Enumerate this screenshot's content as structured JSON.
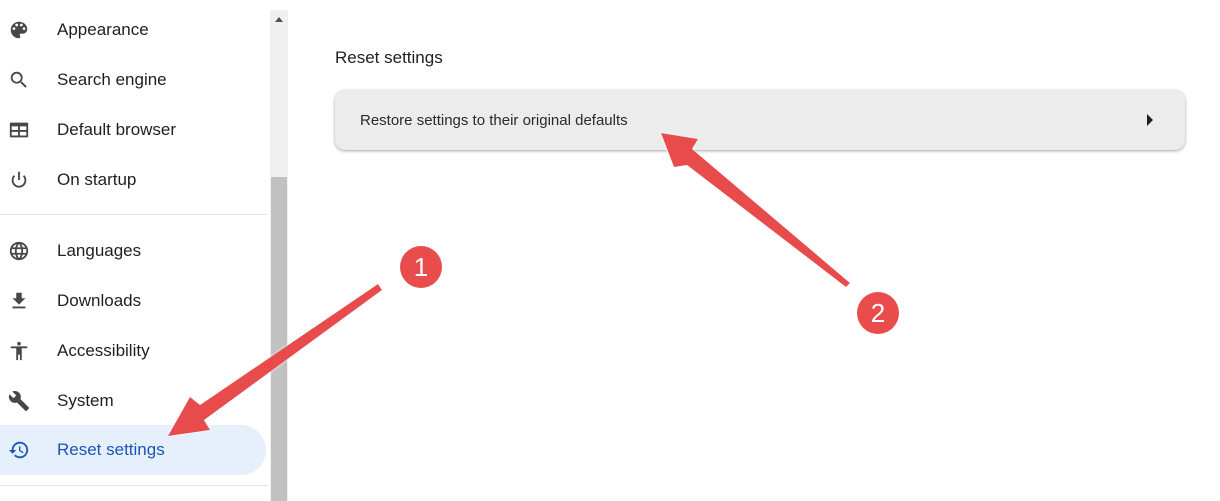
{
  "sidebar": {
    "items": [
      {
        "label": "Appearance",
        "icon": "palette-icon"
      },
      {
        "label": "Search engine",
        "icon": "search-icon"
      },
      {
        "label": "Default browser",
        "icon": "browser-window-icon"
      },
      {
        "label": "On startup",
        "icon": "power-icon"
      },
      {
        "label": "Languages",
        "icon": "globe-icon"
      },
      {
        "label": "Downloads",
        "icon": "download-icon"
      },
      {
        "label": "Accessibility",
        "icon": "accessibility-icon"
      },
      {
        "label": "System",
        "icon": "wrench-icon"
      },
      {
        "label": "Reset settings",
        "icon": "restore-history-icon",
        "active": true
      }
    ]
  },
  "main": {
    "section_title": "Reset settings",
    "card": {
      "label": "Restore settings to their original defaults",
      "arrow_icon": "chevron-right-icon"
    }
  },
  "annotations": {
    "badges": [
      {
        "number": "1",
        "target": "Reset settings sidebar item"
      },
      {
        "number": "2",
        "target": "Restore settings to their original defaults"
      }
    ],
    "color": "#e84c4c"
  }
}
